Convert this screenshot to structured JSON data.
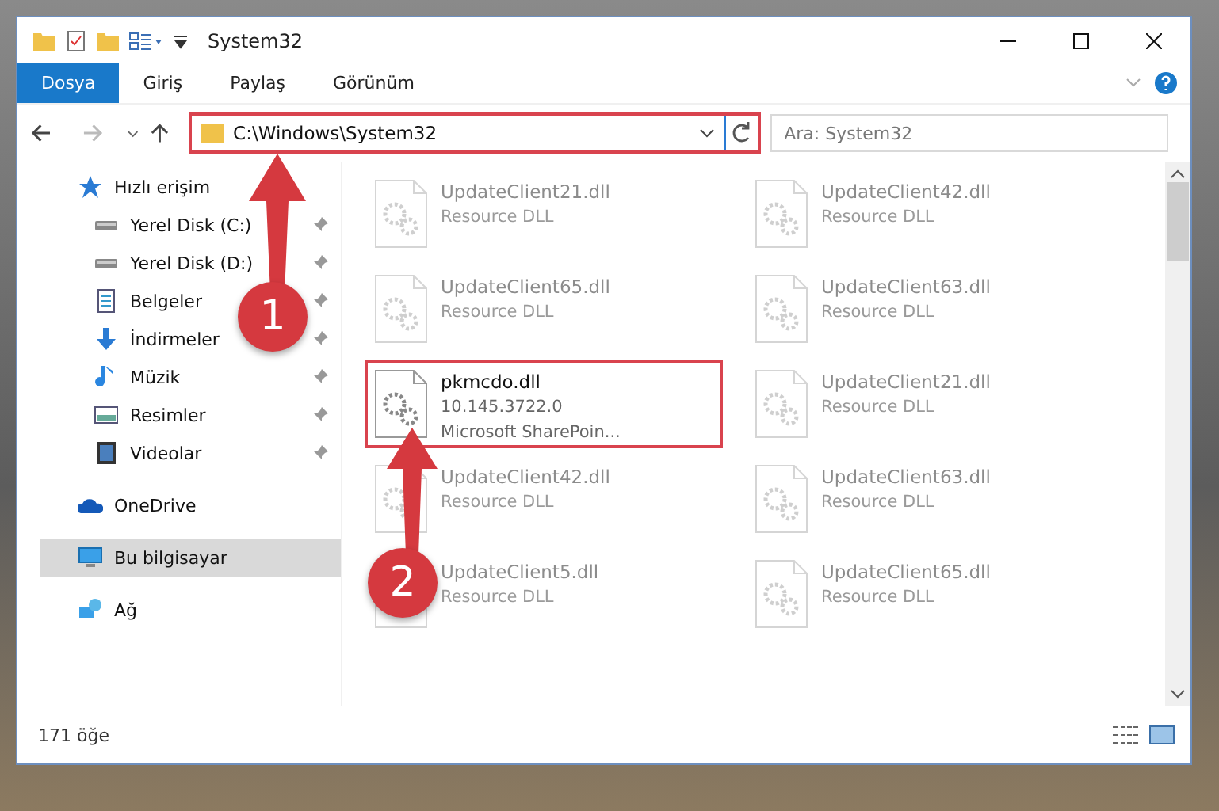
{
  "window": {
    "title": "System32"
  },
  "ribbon": {
    "tabs": [
      {
        "label": "Dosya",
        "selected": true
      },
      {
        "label": "Giriş",
        "selected": false
      },
      {
        "label": "Paylaş",
        "selected": false
      },
      {
        "label": "Görünüm",
        "selected": false
      }
    ]
  },
  "address_bar": {
    "path": "C:\\Windows\\System32",
    "highlighted": true
  },
  "search": {
    "placeholder": "Ara: System32"
  },
  "sidebar": {
    "items": [
      {
        "label": "Hızlı erişim",
        "kind": "group",
        "pinned": false,
        "selected": false
      },
      {
        "label": "Yerel Disk (C:)",
        "kind": "item",
        "pinned": true,
        "selected": false
      },
      {
        "label": "Yerel Disk (D:)",
        "kind": "item",
        "pinned": true,
        "selected": false
      },
      {
        "label": "Belgeler",
        "kind": "item",
        "pinned": true,
        "selected": false
      },
      {
        "label": "İndirmeler",
        "kind": "item",
        "pinned": true,
        "selected": false
      },
      {
        "label": "Müzik",
        "kind": "item",
        "pinned": true,
        "selected": false
      },
      {
        "label": "Resimler",
        "kind": "item",
        "pinned": true,
        "selected": false
      },
      {
        "label": "Videolar",
        "kind": "item",
        "pinned": true,
        "selected": false
      },
      {
        "label": "OneDrive",
        "kind": "group",
        "pinned": false,
        "selected": false
      },
      {
        "label": "Bu bilgisayar",
        "kind": "group",
        "pinned": false,
        "selected": true
      },
      {
        "label": "Ağ",
        "kind": "group",
        "pinned": false,
        "selected": false
      }
    ]
  },
  "files": [
    {
      "name": "UpdateClient21.dll",
      "details": [
        "Resource DLL"
      ],
      "dimmed": true,
      "highlighted": false
    },
    {
      "name": "UpdateClient42.dll",
      "details": [
        "Resource DLL"
      ],
      "dimmed": true,
      "highlighted": false
    },
    {
      "name": "UpdateClient65.dll",
      "details": [
        "Resource DLL"
      ],
      "dimmed": true,
      "highlighted": false
    },
    {
      "name": "UpdateClient63.dll",
      "details": [
        "Resource DLL"
      ],
      "dimmed": true,
      "highlighted": false
    },
    {
      "name": "pkmcdo.dll",
      "details": [
        "10.145.3722.0",
        "Microsoft SharePoin..."
      ],
      "dimmed": false,
      "highlighted": true
    },
    {
      "name": "UpdateClient21.dll",
      "details": [
        "Resource DLL"
      ],
      "dimmed": true,
      "highlighted": false
    },
    {
      "name": "UpdateClient42.dll",
      "details": [
        "Resource DLL"
      ],
      "dimmed": true,
      "highlighted": false
    },
    {
      "name": "UpdateClient63.dll",
      "details": [
        "Resource DLL"
      ],
      "dimmed": true,
      "highlighted": false
    },
    {
      "name": "UpdateClient5.dll",
      "details": [
        "Resource DLL"
      ],
      "dimmed": true,
      "highlighted": false
    },
    {
      "name": "UpdateClient65.dll",
      "details": [
        "Resource DLL"
      ],
      "dimmed": true,
      "highlighted": false
    }
  ],
  "annotations": [
    {
      "number": "1"
    },
    {
      "number": "2"
    }
  ],
  "status_bar": {
    "count": "171 öğe"
  }
}
